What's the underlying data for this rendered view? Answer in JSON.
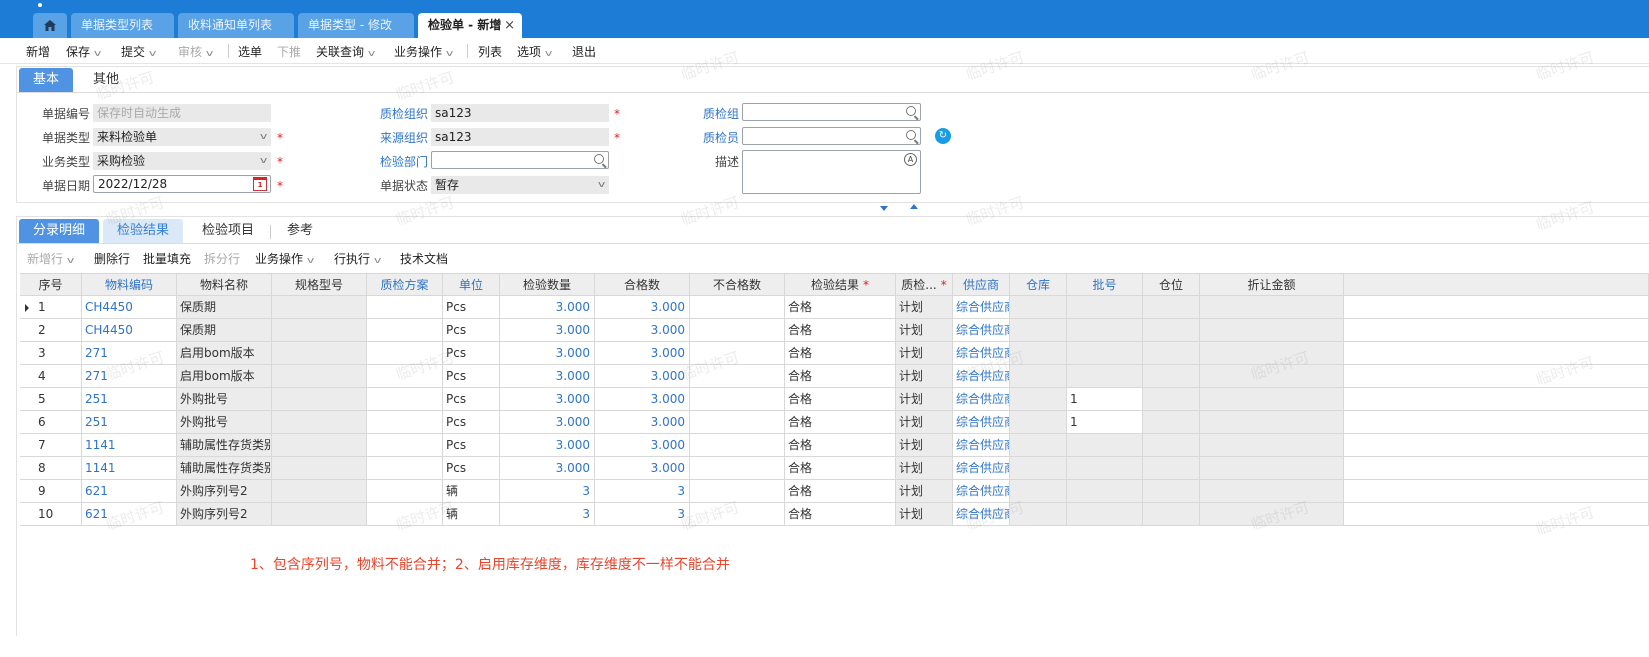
{
  "tabs": [
    {
      "label": ""
    },
    {
      "label": "单据类型列表"
    },
    {
      "label": "收料通知单列表"
    },
    {
      "label": "单据类型 - 修改"
    },
    {
      "label": "检验单 - 新增"
    }
  ],
  "tab_close": "×",
  "toolbar": {
    "new": "新增",
    "save": "保存",
    "submit": "提交",
    "audit": "审核",
    "select": "选单",
    "push": "下推",
    "related": "关联查询",
    "biz": "业务操作",
    "list": "列表",
    "options": "选项",
    "exit": "退出"
  },
  "header_tabs": [
    "基本",
    "其他"
  ],
  "form": {
    "bill_no_label": "单据编号",
    "bill_no_placeholder": "保存时自动生成",
    "bill_type_label": "单据类型",
    "bill_type_value": "来料检验单",
    "biz_type_label": "业务类型",
    "biz_type_value": "采购检验",
    "bill_date_label": "单据日期",
    "bill_date_value": "2022/12/28",
    "qc_org_label": "质检组织",
    "qc_org_value": "sa123",
    "src_org_label": "来源组织",
    "src_org_value": "sa123",
    "insp_dept_label": "检验部门",
    "insp_dept_value": "",
    "status_label": "单据状态",
    "status_value": "暂存",
    "qc_group_label": "质检组",
    "qc_group_value": "",
    "inspector_label": "质检员",
    "inspector_value": "",
    "desc_label": "描述",
    "desc_value": "",
    "required_mark": "*"
  },
  "calendar_day": "1",
  "detail_tabs": [
    "分录明细",
    "检验结果",
    "检验项目",
    "参考"
  ],
  "detail_toolbar": {
    "add_row": "新增行",
    "del_row": "删除行",
    "batch_fill": "批量填充",
    "split_row": "拆分行",
    "biz": "业务操作",
    "row_exec": "行执行",
    "tech_doc": "技术文档"
  },
  "grid": {
    "columns": [
      "序号",
      "物料编码",
      "物料名称",
      "规格型号",
      "质检方案",
      "单位",
      "检验数量",
      "合格数",
      "不合格数",
      "检验结果",
      "质检...",
      "供应商",
      "仓库",
      "批号",
      "仓位",
      "折让金额"
    ],
    "rows": [
      [
        "1",
        "CH4450",
        "保质期",
        "",
        "",
        "Pcs",
        "3.000",
        "3.000",
        "",
        "合格",
        "计划",
        "综合供应商",
        "",
        "",
        "",
        ""
      ],
      [
        "2",
        "CH4450",
        "保质期",
        "",
        "",
        "Pcs",
        "3.000",
        "3.000",
        "",
        "合格",
        "计划",
        "综合供应商",
        "",
        "",
        "",
        ""
      ],
      [
        "3",
        "271",
        "启用bom版本",
        "",
        "",
        "Pcs",
        "3.000",
        "3.000",
        "",
        "合格",
        "计划",
        "综合供应商",
        "",
        "",
        "",
        ""
      ],
      [
        "4",
        "271",
        "启用bom版本",
        "",
        "",
        "Pcs",
        "3.000",
        "3.000",
        "",
        "合格",
        "计划",
        "综合供应商",
        "",
        "",
        "",
        ""
      ],
      [
        "5",
        "251",
        "外购批号",
        "",
        "",
        "Pcs",
        "3.000",
        "3.000",
        "",
        "合格",
        "计划",
        "综合供应商",
        "",
        "1",
        "",
        ""
      ],
      [
        "6",
        "251",
        "外购批号",
        "",
        "",
        "Pcs",
        "3.000",
        "3.000",
        "",
        "合格",
        "计划",
        "综合供应商",
        "",
        "1",
        "",
        ""
      ],
      [
        "7",
        "1141",
        "辅助属性存货类别",
        "",
        "",
        "Pcs",
        "3.000",
        "3.000",
        "",
        "合格",
        "计划",
        "综合供应商",
        "",
        "",
        "",
        ""
      ],
      [
        "8",
        "1141",
        "辅助属性存货类别",
        "",
        "",
        "Pcs",
        "3.000",
        "3.000",
        "",
        "合格",
        "计划",
        "综合供应商",
        "",
        "",
        "",
        ""
      ],
      [
        "9",
        "621",
        "外购序列号2",
        "",
        "",
        "辆",
        "3",
        "3",
        "",
        "合格",
        "计划",
        "综合供应商",
        "",
        "",
        "",
        ""
      ],
      [
        "10",
        "621",
        "外购序列号2",
        "",
        "",
        "辆",
        "3",
        "3",
        "",
        "合格",
        "计划",
        "综合供应商",
        "",
        "",
        "",
        ""
      ]
    ]
  },
  "note": "1、包含序列号，物料不能合并；2、启用库存维度，库存维度不一样不能合并",
  "watermark": "临时许可",
  "colors": {
    "topbar": "#1c7cd6",
    "accent": "#4f93e2",
    "link": "#2f74c8",
    "required": "#e02020",
    "note": "#e8452c"
  }
}
